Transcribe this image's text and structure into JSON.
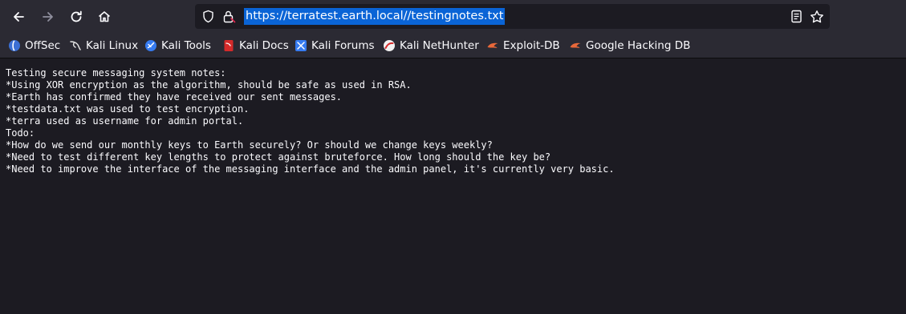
{
  "browser": {
    "url": "https://terratest.earth.local//testingnotes.txt",
    "nav": {
      "back_icon": "arrow-left-icon",
      "forward_icon": "arrow-right-icon",
      "reload_icon": "reload-icon",
      "home_icon": "home-icon"
    },
    "bookmarks": [
      {
        "label": "OffSec",
        "icon": "offsec-icon"
      },
      {
        "label": "Kali Linux",
        "icon": "kali-dragon-icon"
      },
      {
        "label": "Kali Tools",
        "icon": "kali-tools-icon"
      },
      {
        "label": "Kali Docs",
        "icon": "kali-docs-icon"
      },
      {
        "label": "Kali Forums",
        "icon": "kali-forums-icon"
      },
      {
        "label": "Kali NetHunter",
        "icon": "kali-nethunter-icon"
      },
      {
        "label": "Exploit-DB",
        "icon": "exploit-db-icon"
      },
      {
        "label": "Google Hacking DB",
        "icon": "exploit-db-icon"
      }
    ]
  },
  "document": {
    "lines": [
      "Testing secure messaging system notes:",
      "*Using XOR encryption as the algorithm, should be safe as used in RSA.",
      "*Earth has confirmed they have received our sent messages.",
      "*testdata.txt was used to test encryption.",
      "*terra used as username for admin portal.",
      "Todo:",
      "*How do we send our monthly keys to Earth securely? Or should we change keys weekly?",
      "*Need to test different key lengths to protect against bruteforce. How long should the key be?",
      "*Need to improve the interface of the messaging interface and the admin panel, it's currently very basic."
    ]
  }
}
